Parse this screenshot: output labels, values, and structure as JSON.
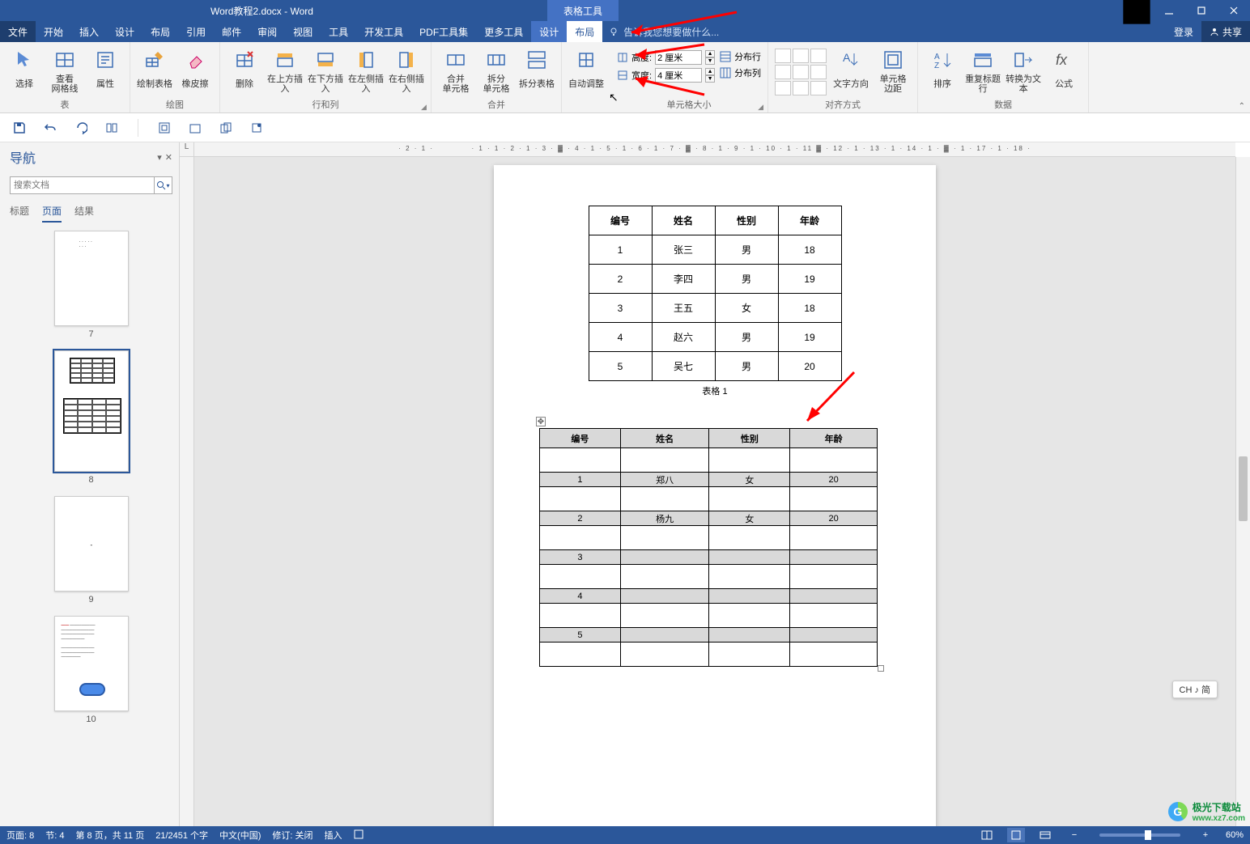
{
  "title": "Word教程2.docx - Word",
  "context_tool_label": "表格工具",
  "tabs": {
    "file": "文件",
    "items": [
      "开始",
      "插入",
      "设计",
      "布局",
      "引用",
      "邮件",
      "审阅",
      "视图",
      "工具",
      "开发工具",
      "PDF工具集",
      "更多工具"
    ],
    "context": [
      "设计",
      "布局"
    ],
    "active": "布局",
    "tell_me": "告诉我您想要做什么...",
    "login": "登录",
    "share": "共享"
  },
  "ribbon": {
    "table_group": {
      "select": "选择",
      "view_grid": "查看\n网格线",
      "properties": "属性",
      "label": "表"
    },
    "drawing_group": {
      "draw": "绘制表格",
      "eraser": "橡皮擦",
      "label": "绘图"
    },
    "rows_cols_group": {
      "delete": "删除",
      "insert_above": "在上方插入",
      "insert_below": "在下方插入",
      "insert_left": "在左侧插入",
      "insert_right": "在右侧插入",
      "label": "行和列"
    },
    "merge_group": {
      "merge": "合并\n单元格",
      "split": "拆分\n单元格",
      "split_table": "拆分表格",
      "label": "合并"
    },
    "autofit_group": {
      "autofit": "自动调整"
    },
    "cell_size_group": {
      "height_label": "高度:",
      "height_value": "2 厘米",
      "width_label": "宽度:",
      "width_value": "4 厘米",
      "dist_rows": "分布行",
      "dist_cols": "分布列",
      "label": "单元格大小"
    },
    "align_group": {
      "text_dir": "文字方向",
      "cell_margins": "单元格\n边距",
      "label": "对齐方式"
    },
    "data_group": {
      "sort": "排序",
      "repeat_header": "重复标题行",
      "convert": "转换为文本",
      "formula": "公式",
      "label": "数据"
    }
  },
  "nav": {
    "title": "导航",
    "search_placeholder": "搜索文档",
    "tabs": [
      "标题",
      "页面",
      "结果"
    ],
    "active_tab": "页面",
    "thumbs": [
      {
        "num": "7"
      },
      {
        "num": "8"
      },
      {
        "num": "9"
      },
      {
        "num": "10"
      }
    ]
  },
  "ruler_corner": "L",
  "document": {
    "table1": {
      "headers": [
        "编号",
        "姓名",
        "性别",
        "年龄"
      ],
      "rows": [
        [
          "1",
          "张三",
          "男",
          "18"
        ],
        [
          "2",
          "李四",
          "男",
          "19"
        ],
        [
          "3",
          "王五",
          "女",
          "18"
        ],
        [
          "4",
          "赵六",
          "男",
          "19"
        ],
        [
          "5",
          "吴七",
          "男",
          "20"
        ]
      ],
      "caption": "表格 1"
    },
    "table2": {
      "headers": [
        "编号",
        "姓名",
        "性别",
        "年龄"
      ],
      "rows": [
        [
          "1",
          "郑八",
          "女",
          "20"
        ],
        [
          "2",
          "杨九",
          "女",
          "20"
        ],
        [
          "3",
          "",
          "",
          ""
        ],
        [
          "4",
          "",
          "",
          ""
        ],
        [
          "5",
          "",
          "",
          ""
        ]
      ]
    }
  },
  "status": {
    "page": "页面: 8",
    "section": "节: 4",
    "page_of": "第 8 页，共 11 页",
    "words": "21/2451 个字",
    "lang": "中文(中国)",
    "track": "修订: 关闭",
    "mode": "插入",
    "zoom": "60%"
  },
  "ime": "CH ♪ 简",
  "watermark": "极光下载站",
  "watermark_url": "www.xz7.com"
}
